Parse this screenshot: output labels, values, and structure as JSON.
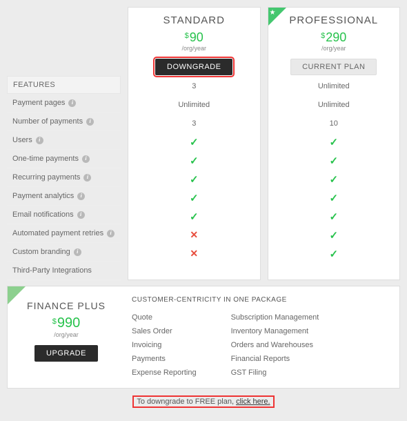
{
  "features_header": "FEATURES",
  "features": [
    {
      "label": "Payment pages",
      "info": true
    },
    {
      "label": "Number of payments",
      "info": true
    },
    {
      "label": "Users",
      "info": true
    },
    {
      "label": "One-time payments",
      "info": true
    },
    {
      "label": "Recurring payments",
      "info": true
    },
    {
      "label": "Payment analytics",
      "info": true
    },
    {
      "label": "Email notifications",
      "info": true
    },
    {
      "label": "Automated payment retries",
      "info": true
    },
    {
      "label": "Custom branding",
      "info": true
    },
    {
      "label": "Third-Party Integrations",
      "info": false
    }
  ],
  "plans": {
    "standard": {
      "title": "STANDARD",
      "currency": "$",
      "price": "90",
      "unit": "/org/year",
      "button": "DOWNGRADE",
      "cells": [
        "3",
        "Unlimited",
        "3",
        "check",
        "check",
        "check",
        "check",
        "check",
        "cross",
        "cross"
      ]
    },
    "professional": {
      "title": "PROFESSIONAL",
      "currency": "$",
      "price": "290",
      "unit": "/org/year",
      "button": "CURRENT PLAN",
      "cells": [
        "Unlimited",
        "Unlimited",
        "10",
        "check",
        "check",
        "check",
        "check",
        "check",
        "check",
        "check"
      ]
    }
  },
  "finance": {
    "title": "FINANCE PLUS",
    "currency": "$",
    "price": "990",
    "unit": "/org/year",
    "button": "UPGRADE",
    "heading": "CUSTOMER-CENTRICITY IN ONE PACKAGE",
    "col1": [
      "Quote",
      "Sales Order",
      "Invoicing",
      "Payments",
      "Expense Reporting"
    ],
    "col2": [
      "Subscription Management",
      "Inventory Management",
      "Orders and Warehouses",
      "Financial Reports",
      "GST Filing"
    ]
  },
  "footer": {
    "text": "To downgrade to FREE plan, ",
    "link": "click here."
  }
}
